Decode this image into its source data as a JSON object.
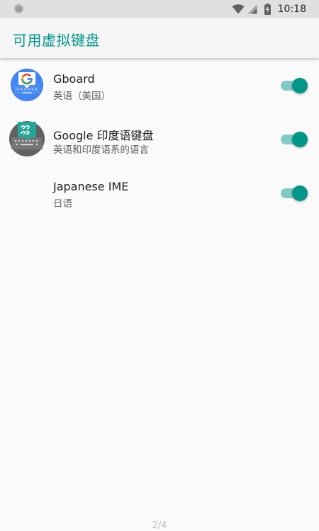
{
  "status_bar": {
    "time": "10:18",
    "icons": [
      "notification-dot-icon",
      "wifi-icon",
      "cell-signal-icon",
      "battery-charging-icon"
    ]
  },
  "app_bar": {
    "title": "可用虚拟键盘"
  },
  "keyboards": [
    {
      "title": "Gboard",
      "subtitle": "英语（美国）",
      "icon": "gboard-icon",
      "enabled": true
    },
    {
      "title": "Google 印度语键盘",
      "subtitle": "英语和印度语系的语言",
      "icon": "indic-keyboard-icon",
      "enabled": true
    },
    {
      "title": "Japanese IME",
      "subtitle": "日语",
      "icon": "",
      "enabled": true
    }
  ],
  "page_indicator": "2/4",
  "colors": {
    "accent": "#009688",
    "accent_light": "#80cbc4",
    "status_bar": "#e0e0e0",
    "background": "#fafafa"
  }
}
